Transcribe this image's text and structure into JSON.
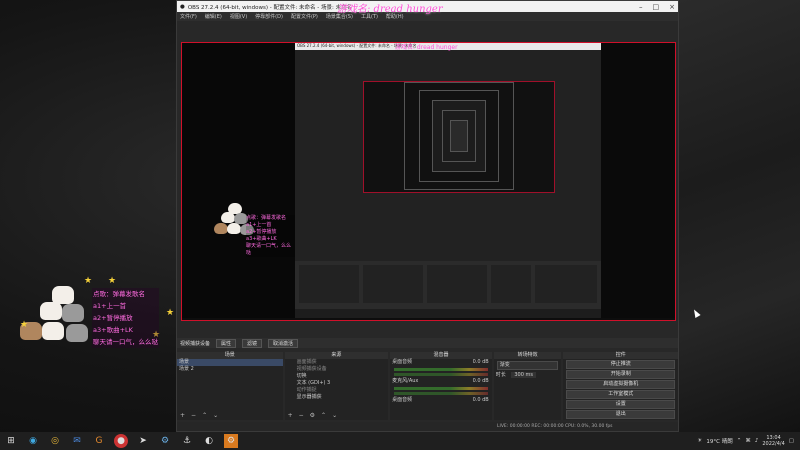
{
  "window": {
    "title": "OBS 27.2.4 (64-bit, windows) - 配置文件: 未命名 - 场景: 未命名",
    "overlay_text": "游戏名: dread hunger",
    "menu": [
      "文件(F)",
      "编辑(E)",
      "视图(V)",
      "停靠部件(D)",
      "配置文件(P)",
      "场景集合(S)",
      "工具(T)",
      "帮助(H)"
    ]
  },
  "nested": {
    "title": "OBS 27.2.4 (64-bit, windows) - 配置文件: 未命名 - 场景: 未命名",
    "overlay_text": "游戏名: dread hunger"
  },
  "subtitles_small": [
    "点歌：弹幕发歌名",
    "a1+上一首",
    "a2+暂停播放",
    "a3+歌曲+LK",
    "聊天请一口气，么么哒"
  ],
  "subtitles": [
    "点歌：弹幕发歌名",
    "a1+上一首",
    "a2+暂停播放",
    "a3+歌曲+LK",
    "聊天请一口气，么么哒"
  ],
  "controls": {
    "source_label": "视频捕获设备",
    "properties_label": "属性",
    "filters_label": "滤镜",
    "deactivate_label": "取消激活"
  },
  "docks": {
    "scenes": {
      "title": "场景",
      "items": [
        "场景",
        "场景 2"
      ]
    },
    "sources": {
      "title": "来源",
      "items": [
        "画面捕获",
        "视频捕获设备",
        "切换",
        "文本 (GDI+) 3",
        "动作捕捉",
        "显示器捕获"
      ]
    },
    "mixer": {
      "title": "混音器",
      "channels": [
        "桌面音频",
        "麦克风/Aux",
        "桌面音频"
      ],
      "levels": [
        "0.0 dB",
        "0.0 dB",
        "0.0 dB"
      ]
    },
    "transitions": {
      "title": "转场特效",
      "type": "渐变",
      "duration_label": "时长",
      "duration": "300 ms"
    },
    "controls": {
      "title": "控件",
      "buttons": [
        "停止推流",
        "开始录制",
        "启动虚拟摄像机",
        "工作室模式",
        "设置",
        "退出"
      ]
    }
  },
  "status": "LIVE: 00:00:00   REC: 00:00:00   CPU: 0.0%, 30.00 fps",
  "taskbar": {
    "weather": "19°C 晴朗",
    "time": "13:04",
    "date": "2022/4/4",
    "icons": [
      "windows-icon",
      "edge-icon",
      "chrome-icon",
      "mail-icon",
      "g-icon",
      "red-app-icon",
      "arrow-icon",
      "steam-icon",
      "anchor-icon",
      "obs-icon",
      "steam-icon"
    ]
  }
}
